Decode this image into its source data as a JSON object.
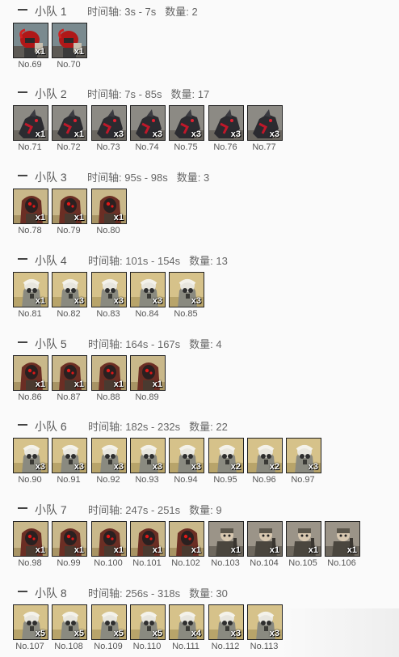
{
  "labels": {
    "timeline": "时间轴: ",
    "count": "数量: "
  },
  "squads": [
    {
      "title": "小队 1",
      "time": "3s - 7s",
      "count": "2",
      "members": [
        {
          "no": "No.69",
          "qty": "x1",
          "art": "red-helmet"
        },
        {
          "no": "No.70",
          "qty": "x1",
          "art": "red-helmet"
        }
      ]
    },
    {
      "title": "小队 2",
      "time": "7s - 85s",
      "count": "17",
      "members": [
        {
          "no": "No.71",
          "qty": "x1",
          "art": "dark-beast"
        },
        {
          "no": "No.72",
          "qty": "x1",
          "art": "dark-beast"
        },
        {
          "no": "No.73",
          "qty": "x3",
          "art": "dark-beast"
        },
        {
          "no": "No.74",
          "qty": "x3",
          "art": "dark-beast"
        },
        {
          "no": "No.75",
          "qty": "x3",
          "art": "dark-beast"
        },
        {
          "no": "No.76",
          "qty": "x3",
          "art": "dark-beast"
        },
        {
          "no": "No.77",
          "qty": "x3",
          "art": "dark-beast"
        }
      ]
    },
    {
      "title": "小队 3",
      "time": "95s - 98s",
      "count": "3",
      "members": [
        {
          "no": "No.78",
          "qty": "x1",
          "art": "red-hood"
        },
        {
          "no": "No.79",
          "qty": "x1",
          "art": "red-hood"
        },
        {
          "no": "No.80",
          "qty": "x1",
          "art": "red-hood"
        }
      ]
    },
    {
      "title": "小队 4",
      "time": "101s - 154s",
      "count": "13",
      "members": [
        {
          "no": "No.81",
          "qty": "x1",
          "art": "gas-mask"
        },
        {
          "no": "No.82",
          "qty": "x3",
          "art": "gas-mask"
        },
        {
          "no": "No.83",
          "qty": "x3",
          "art": "gas-mask"
        },
        {
          "no": "No.84",
          "qty": "x3",
          "art": "gas-mask"
        },
        {
          "no": "No.85",
          "qty": "x3",
          "art": "gas-mask"
        }
      ]
    },
    {
      "title": "小队 5",
      "time": "164s - 167s",
      "count": "4",
      "members": [
        {
          "no": "No.86",
          "qty": "x1",
          "art": "red-hood"
        },
        {
          "no": "No.87",
          "qty": "x1",
          "art": "red-hood"
        },
        {
          "no": "No.88",
          "qty": "x1",
          "art": "red-hood"
        },
        {
          "no": "No.89",
          "qty": "x1",
          "art": "red-hood"
        }
      ]
    },
    {
      "title": "小队 6",
      "time": "182s - 232s",
      "count": "22",
      "members": [
        {
          "no": "No.90",
          "qty": "x3",
          "art": "gas-mask"
        },
        {
          "no": "No.91",
          "qty": "x3",
          "art": "gas-mask"
        },
        {
          "no": "No.92",
          "qty": "x3",
          "art": "gas-mask"
        },
        {
          "no": "No.93",
          "qty": "x3",
          "art": "gas-mask"
        },
        {
          "no": "No.94",
          "qty": "x3",
          "art": "gas-mask"
        },
        {
          "no": "No.95",
          "qty": "x2",
          "art": "gas-mask"
        },
        {
          "no": "No.96",
          "qty": "x2",
          "art": "gas-mask"
        },
        {
          "no": "No.97",
          "qty": "x3",
          "art": "gas-mask"
        }
      ]
    },
    {
      "title": "小队 7",
      "time": "247s - 251s",
      "count": "9",
      "members": [
        {
          "no": "No.98",
          "qty": "x1",
          "art": "red-hood"
        },
        {
          "no": "No.99",
          "qty": "x1",
          "art": "red-hood"
        },
        {
          "no": "No.100",
          "qty": "x1",
          "art": "red-hood"
        },
        {
          "no": "No.101",
          "qty": "x1",
          "art": "red-hood"
        },
        {
          "no": "No.102",
          "qty": "x1",
          "art": "red-hood"
        },
        {
          "no": "No.103",
          "qty": "x1",
          "art": "soldier"
        },
        {
          "no": "No.104",
          "qty": "x1",
          "art": "soldier"
        },
        {
          "no": "No.105",
          "qty": "x1",
          "art": "soldier"
        },
        {
          "no": "No.106",
          "qty": "x1",
          "art": "soldier"
        }
      ]
    },
    {
      "title": "小队 8",
      "time": "256s - 318s",
      "count": "30",
      "members": [
        {
          "no": "No.107",
          "qty": "x5",
          "art": "gas-mask"
        },
        {
          "no": "No.108",
          "qty": "x5",
          "art": "gas-mask"
        },
        {
          "no": "No.109",
          "qty": "x5",
          "art": "gas-mask"
        },
        {
          "no": "No.110",
          "qty": "x5",
          "art": "gas-mask"
        },
        {
          "no": "No.111",
          "qty": "x4",
          "art": "gas-mask"
        },
        {
          "no": "No.112",
          "qty": "x3",
          "art": "gas-mask"
        },
        {
          "no": "No.113",
          "qty": "x3",
          "art": "gas-mask"
        }
      ]
    }
  ]
}
